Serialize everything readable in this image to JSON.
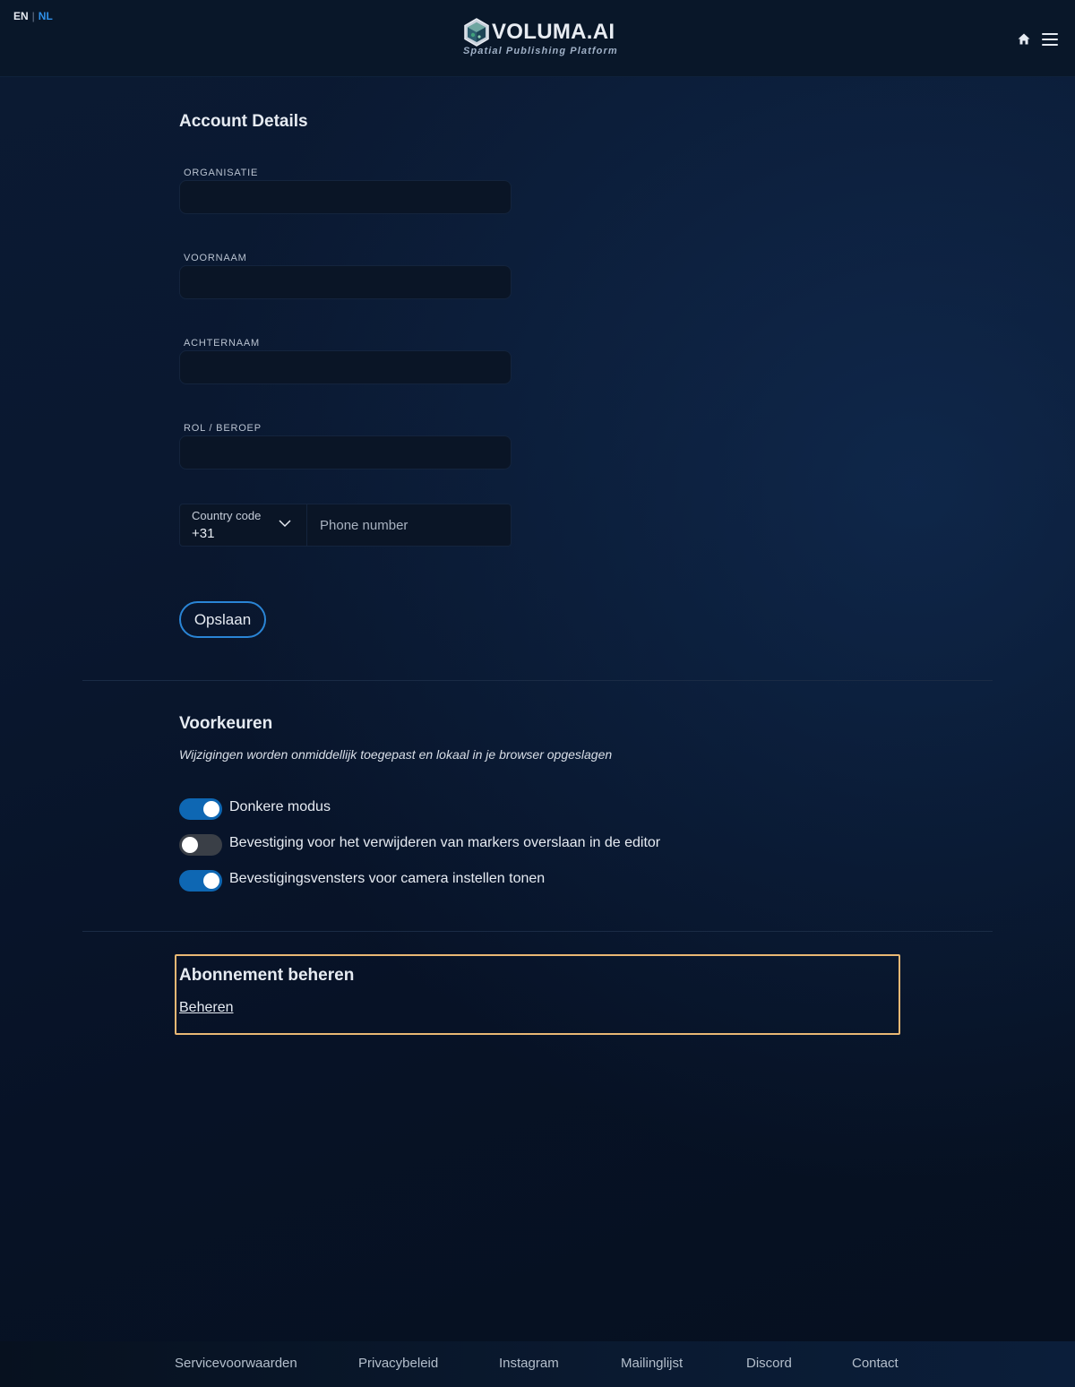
{
  "header": {
    "lang_en": "EN",
    "lang_sep": "|",
    "lang_nl": "NL",
    "brand": "VOLUMA.AI",
    "tagline": "Spatial Publishing Platform",
    "icons": [
      "home-icon",
      "menu-icon"
    ]
  },
  "account": {
    "title": "Account Details",
    "fields": [
      {
        "label": "ORGANISATIE",
        "value": ""
      },
      {
        "label": "VOORNAAM",
        "value": ""
      },
      {
        "label": "ACHTERNAAM",
        "value": ""
      },
      {
        "label": "ROL / BEROEP",
        "value": ""
      }
    ],
    "phone": {
      "country_label": "Country code",
      "country_value": "+31",
      "placeholder": "Phone number",
      "value": ""
    },
    "save_label": "Opslaan"
  },
  "preferences": {
    "title": "Voorkeuren",
    "subtitle": "Wijzigingen worden onmiddellijk toegepast en lokaal in je browser opgeslagen",
    "toggles": [
      {
        "label": "Donkere modus",
        "on": true
      },
      {
        "label": "Bevestiging voor het verwijderen van markers overslaan in de editor",
        "on": false
      },
      {
        "label": "Bevestigingsvensters voor camera instellen tonen",
        "on": true
      }
    ]
  },
  "subscription": {
    "title": "Abonnement beheren",
    "link": "Beheren"
  },
  "footer": {
    "links": [
      "Servicevoorwaarden",
      "Privacybeleid",
      "Instagram",
      "Mailinglijst",
      "Discord",
      "Contact"
    ]
  },
  "colors": {
    "accent": "#2a85d6",
    "toggle_on": "#0e67b3",
    "highlight": "#e9b874"
  }
}
